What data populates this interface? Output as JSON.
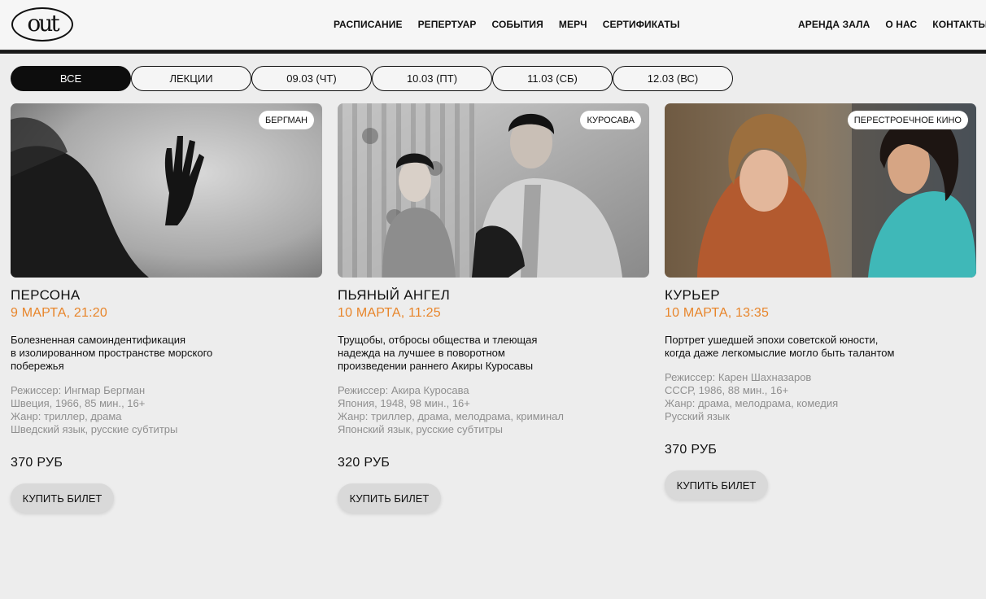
{
  "logo": {
    "text": "out"
  },
  "nav": {
    "main": [
      "РАСПИСАНИЕ",
      "РЕПЕРТУАР",
      "СОБЫТИЯ",
      "МЕРЧ",
      "СЕРТИФИКАТЫ"
    ],
    "right": [
      "АРЕНДА ЗАЛА",
      "О НАС",
      "КОНТАКТЫ"
    ]
  },
  "filters": [
    {
      "label": "ВСЕ",
      "active": true
    },
    {
      "label": "ЛЕКЦИИ",
      "active": false
    },
    {
      "label": "09.03 (ЧТ)",
      "active": false
    },
    {
      "label": "10.03 (ПТ)",
      "active": false
    },
    {
      "label": "11.03 (СБ)",
      "active": false
    },
    {
      "label": "12.03 (ВС)",
      "active": false
    }
  ],
  "cards": [
    {
      "tag": "БЕРГМАН",
      "title": "ПЕРСОНА",
      "when": "9 МАРТА, 21:20",
      "desc": [
        "Болезненная самоиндентификация",
        "в изолированном пространстве морского",
        "побережья"
      ],
      "meta": [
        "Режиссер: Ингмар Бергман",
        "Швеция, 1966, 85 мин., 16+",
        "Жанр: триллер, драма",
        "Шведский язык, русские субтитры"
      ],
      "price": "370 РУБ",
      "buy": "КУПИТЬ БИЛЕТ"
    },
    {
      "tag": "КУРОСАВА",
      "title": "ПЬЯНЫЙ АНГЕЛ",
      "when": "10 МАРТА, 11:25",
      "desc": [
        "Трущобы, отбросы общества и тлеющая",
        "надежда на лучшее в поворотном",
        "произведении раннего Акиры Куросавы"
      ],
      "meta": [
        "Режиссер: Акира Куросава",
        "Япония, 1948, 98 мин., 16+",
        "Жанр: триллер, драма, мелодрама, криминал",
        "Японский язык, русские субтитры"
      ],
      "price": "320 РУБ",
      "buy": "КУПИТЬ БИЛЕТ"
    },
    {
      "tag": "ПЕРЕСТРОЕЧНОЕ КИНО",
      "title": "КУРЬЕР",
      "when": "10 МАРТА, 13:35",
      "desc": [
        "Портрет ушедшей эпохи советской юности,",
        "когда даже легкомыслие могло быть талантом"
      ],
      "meta": [
        "Режиссер: Карен Шахназаров",
        "СССР, 1986, 88 мин., 16+",
        "Жанр: драма, мелодрама, комедия",
        "Русский язык"
      ],
      "price": "370 РУБ",
      "buy": "КУПИТЬ БИЛЕТ"
    }
  ],
  "colors": {
    "accent": "#e8852a",
    "page_bg": "#ededed",
    "chip_active": "#0d0d0d"
  }
}
